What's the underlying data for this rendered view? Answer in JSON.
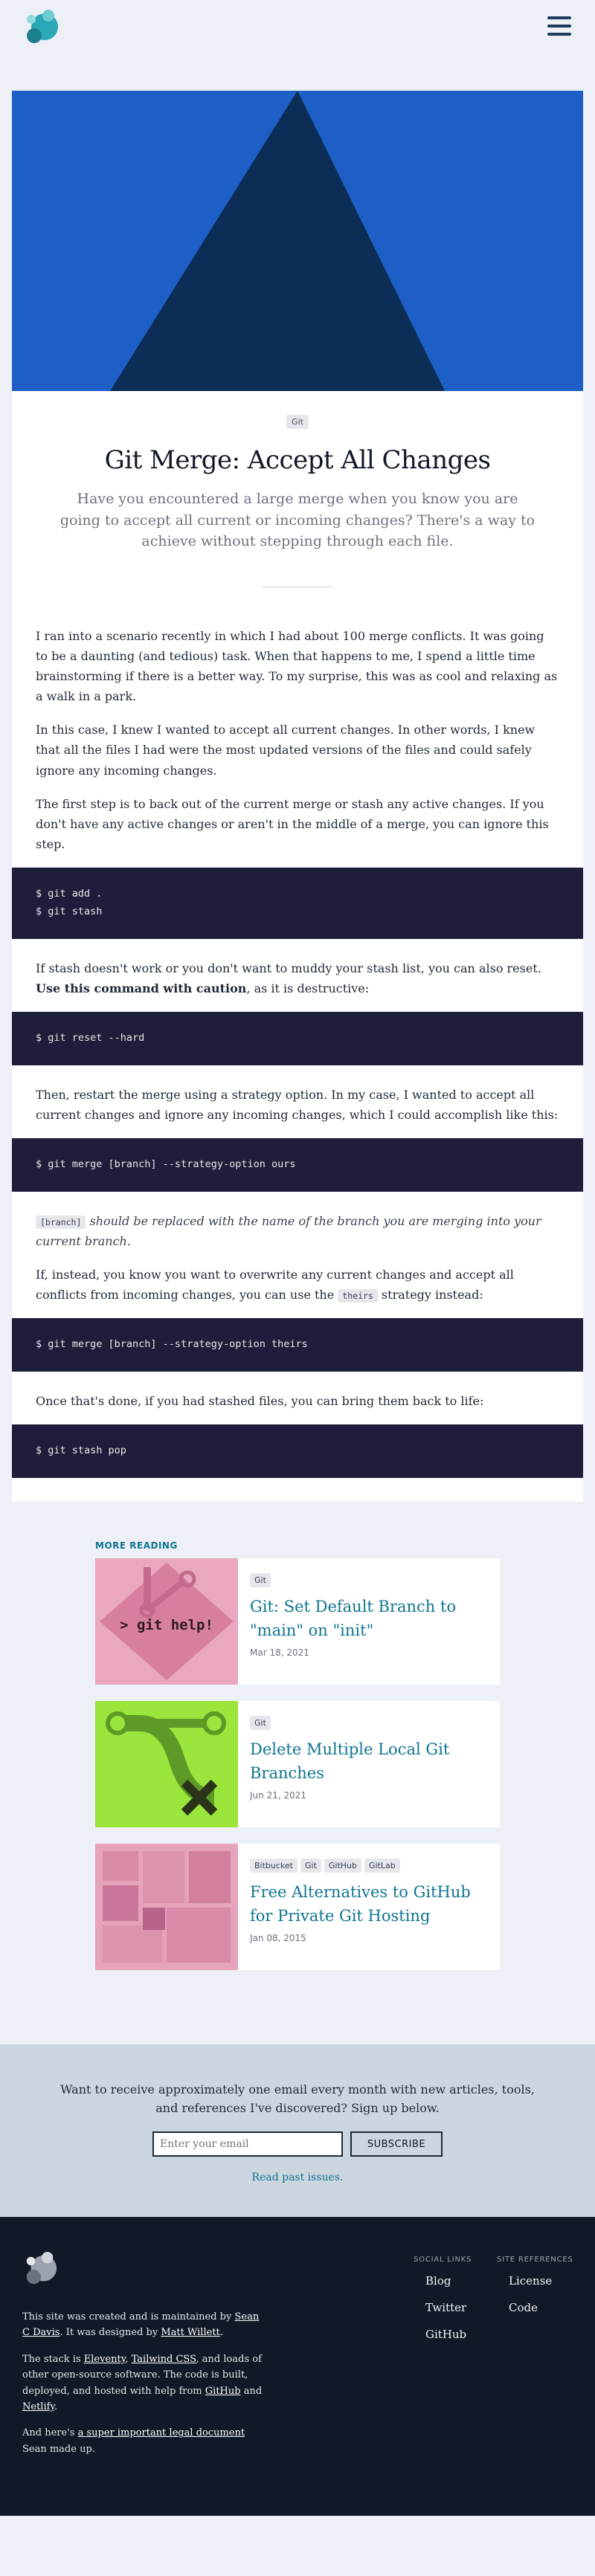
{
  "header": {
    "logo_icon": "site-logo-icon",
    "menu_icon": "hamburger-menu-icon"
  },
  "article": {
    "tag": "Git",
    "title": "Git Merge: Accept All Changes",
    "subtitle": "Have you encountered a large merge when you know you are going to accept all current or incoming changes? There's a way to achieve without stepping through each file.",
    "p1": "I ran into a scenario recently in which I had about 100 merge conflicts. It was going to be a daunting (and tedious) task. When that happens to me, I spend a little time brainstorming if there is a better way. To my surprise, this was as cool and relaxing as a walk in a park.",
    "p2": "In this case, I knew I wanted to accept all current changes. In other words, I knew that all the files I had were the most updated versions of the files and could safely ignore any incoming changes.",
    "p3": "The first step is to back out of the current merge or stash any active changes. If you don't have any active changes or aren't in the middle of a merge, you can ignore this step.",
    "code1": [
      "$ git add .",
      "$ git stash"
    ],
    "p4_a": "If stash doesn't work or you don't want to muddy your stash list, you can also reset. ",
    "p4_b": "Use this command with caution",
    "p4_c": ", as it is destructive:",
    "code2": [
      "$ git reset --hard"
    ],
    "p5": "Then, restart the merge using a strategy option. In my case, I wanted to accept all current changes and ignore any incoming changes, which I could accomplish like this:",
    "code3": [
      "$ git merge [branch] --strategy-option ours"
    ],
    "p6_code": "[branch]",
    "p6_text": " should be replaced with the name of the branch you are merging into your current branch.",
    "p7_a": "If, instead, you know you want to overwrite any current changes and accept all conflicts from incoming changes, you can use the ",
    "p7_code": "theirs",
    "p7_b": " strategy instead:",
    "code4": [
      "$ git merge [branch] --strategy-option theirs"
    ],
    "p8": "Once that's done, if you had stashed files, you can bring them back to life:",
    "code5": [
      "$ git stash pop"
    ]
  },
  "more_reading": {
    "label": "MORE READING",
    "cards": [
      {
        "tags": [
          "Git"
        ],
        "title": "Git: Set Default Branch to \"main\" on \"init\"",
        "date": "Mar 18, 2021",
        "image_text": "> git help!"
      },
      {
        "tags": [
          "Git"
        ],
        "title": "Delete Multiple Local Git Branches",
        "date": "Jun 21, 2021"
      },
      {
        "tags": [
          "Bitbucket",
          "Git",
          "GitHub",
          "GitLab"
        ],
        "title": "Free Alternatives to GitHub for Private Git Hosting",
        "date": "Jan 08, 2015"
      }
    ]
  },
  "newsletter": {
    "text": "Want to receive approximately one email every month with new articles, tools, and references I've discovered? Sign up below.",
    "placeholder": "Enter your email",
    "button": "SUBSCRIBE",
    "past": "Read past issues."
  },
  "footer": {
    "t1_a": "This site was created and is maintained by ",
    "t1_link1": "Sean C Davis",
    "t1_b": ". It was designed by ",
    "t1_link2": "Matt Willett",
    "t1_c": ".",
    "t2_a": "The stack is ",
    "t2_l1": "Eleventy",
    "t2_s1": ", ",
    "t2_l2": "Tailwind CSS",
    "t2_b": ", and loads of other open-source software. The code is built, deployed, and hosted with help from ",
    "t2_l3": "GitHub",
    "t2_c": " and ",
    "t2_l4": "Netlify",
    "t2_d": ".",
    "t3_a": "And here's ",
    "t3_link": "a super important legal document",
    "t3_b": " Sean made up.",
    "social_heading": "SOCIAL LINKS",
    "social": [
      "Blog",
      "Twitter",
      "GitHub"
    ],
    "refs_heading": "SITE REFERENCES",
    "refs": [
      "License",
      "Code"
    ]
  },
  "colors": {
    "accent": "#0e7490",
    "hero_blue": "#1d5fc7",
    "hero_dark": "#0b2d56",
    "code_bg": "#1e1e3a",
    "footer_bg": "#111827"
  }
}
